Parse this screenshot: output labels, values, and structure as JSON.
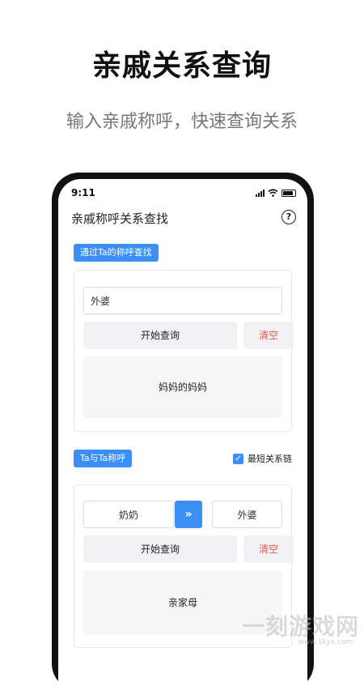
{
  "banner": {
    "headline": "亲戚关系查询",
    "subline": "输入亲戚称呼，快速查询关系"
  },
  "status": {
    "time": "9:11"
  },
  "app": {
    "title": "亲戚称呼关系查找",
    "help_icon": "question-circle-icon"
  },
  "section1": {
    "tag": "通过Ta的称呼查找",
    "input_value": "外婆",
    "query_button": "开始查询",
    "clear_button": "清空",
    "result": "妈妈的妈妈"
  },
  "section2": {
    "tag": "Ta与Ta称呼",
    "checkbox_label": "最短关系链",
    "checkbox_checked": true,
    "from_value": "奶奶",
    "swap_icon": "double-chevron-right-icon",
    "to_value": "外婆",
    "query_button": "开始查询",
    "clear_button": "清空",
    "result": "亲家母"
  },
  "colors": {
    "accent": "#3b8ff2",
    "danger": "#e85a4f"
  },
  "watermark": {
    "text": "一刻游戏网",
    "url": "www.1kyx.com"
  }
}
